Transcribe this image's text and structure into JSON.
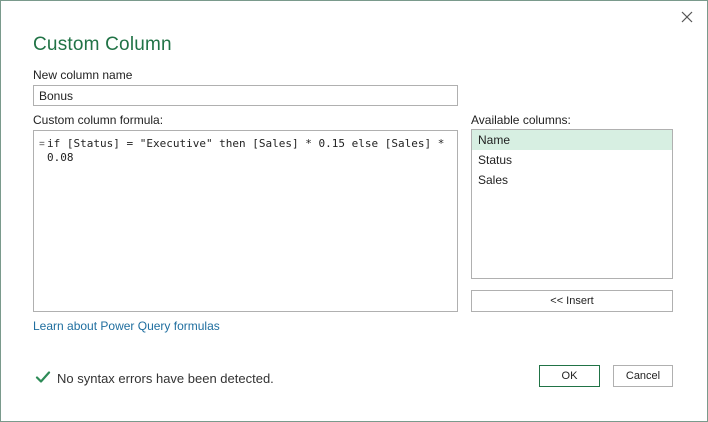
{
  "dialog": {
    "title": "Custom Column",
    "close_icon": "close-icon"
  },
  "name_field": {
    "label": "New column name",
    "value": "Bonus"
  },
  "formula": {
    "label": "Custom column formula:",
    "prefix": "=",
    "text": "if [Status] = \"Executive\" then [Sales] * 0.15 else [Sales] *\n0.08"
  },
  "available_columns": {
    "label": "Available columns:",
    "items": [
      "Name",
      "Status",
      "Sales"
    ],
    "selected": "Name"
  },
  "buttons": {
    "insert": "<< Insert",
    "ok": "OK",
    "cancel": "Cancel"
  },
  "link": {
    "text": "Learn about Power Query formulas"
  },
  "status": {
    "icon": "checkmark-icon",
    "text": "No syntax errors have been detected."
  },
  "colors": {
    "accent": "#217346",
    "link": "#1f6e9f",
    "selection": "#d7efe2",
    "check": "#217346"
  }
}
